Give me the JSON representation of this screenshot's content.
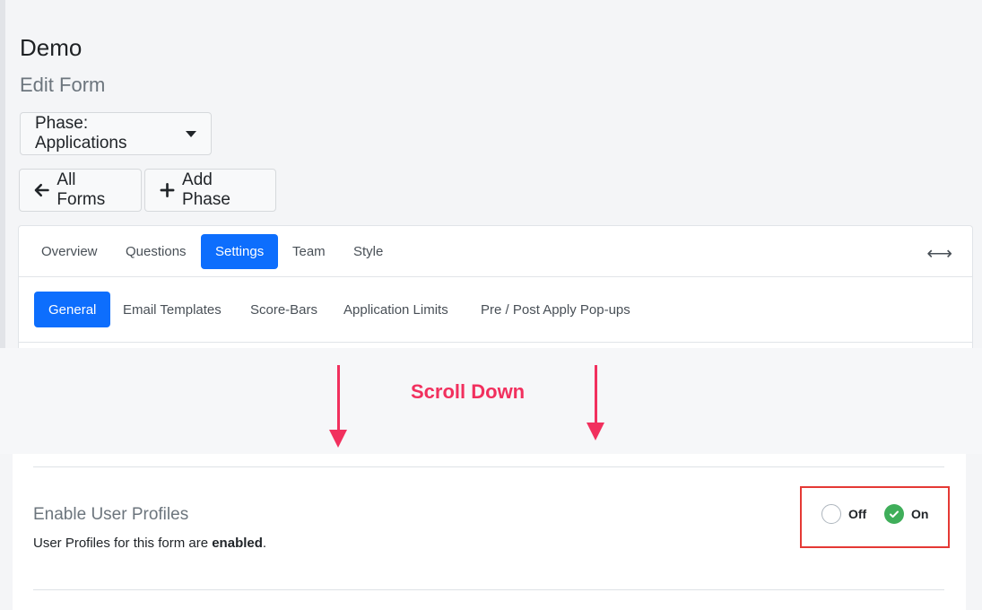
{
  "page": {
    "title": "Demo",
    "subtitle": "Edit Form"
  },
  "phase_dropdown": {
    "label": "Phase: Applications",
    "icon": "caret-down-icon"
  },
  "actions": {
    "all_forms": "All Forms",
    "add_phase": "Add Phase"
  },
  "tabs": [
    {
      "label": "Overview",
      "active": false
    },
    {
      "label": "Questions",
      "active": false
    },
    {
      "label": "Settings",
      "active": true
    },
    {
      "label": "Team",
      "active": false
    },
    {
      "label": "Style",
      "active": false
    }
  ],
  "subtabs": [
    {
      "label": "General",
      "active": true
    },
    {
      "label": "Email Templates",
      "active": false
    },
    {
      "label": "Score-Bars",
      "active": false
    },
    {
      "label": "Application Limits",
      "active": false
    },
    {
      "label": "Pre / Post Apply Pop-ups",
      "active": false
    }
  ],
  "annotation": {
    "text": "Scroll Down",
    "color": "#f1305e"
  },
  "setting": {
    "title": "Enable User Profiles",
    "desc_prefix": "User Profiles for this form are ",
    "desc_bold": "enabled",
    "desc_suffix": ".",
    "options": {
      "off": "Off",
      "on": "On"
    },
    "selected": "On"
  },
  "colors": {
    "primary": "#0d6efd",
    "success": "#3fae5a",
    "highlight": "#e53935"
  }
}
